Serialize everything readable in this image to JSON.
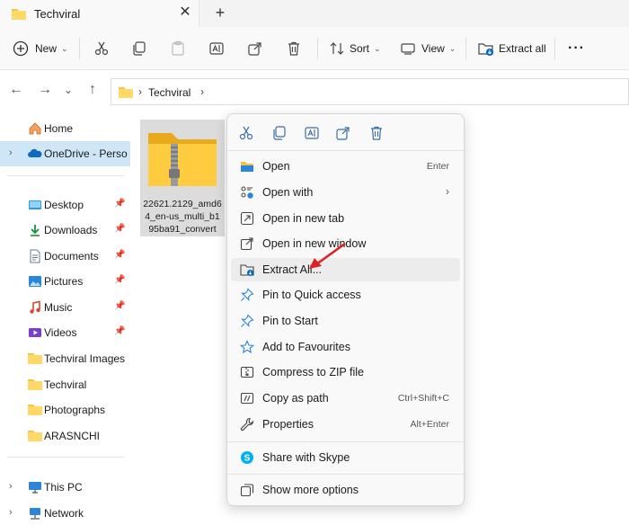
{
  "tab": {
    "title": "Techviral",
    "close": "✕",
    "new_tab": "+"
  },
  "commandbar": {
    "new_label": "New",
    "sort_label": "Sort",
    "view_label": "View",
    "extract_all_label": "Extract all",
    "more": "···"
  },
  "address": {
    "crumb": "Techviral",
    "sep": "›"
  },
  "sidebar": {
    "items": [
      {
        "label": "Home"
      },
      {
        "label": "OneDrive - Persona"
      },
      {
        "label": "Desktop"
      },
      {
        "label": "Downloads"
      },
      {
        "label": "Documents"
      },
      {
        "label": "Pictures"
      },
      {
        "label": "Music"
      },
      {
        "label": "Videos"
      },
      {
        "label": "Techviral Images"
      },
      {
        "label": "Techviral"
      },
      {
        "label": "Photographs"
      },
      {
        "label": "ARASNCHI"
      },
      {
        "label": "This PC"
      },
      {
        "label": "Network"
      }
    ]
  },
  "file": {
    "name": "22621.2129_amd64_en-us_multi_b195ba91_convert"
  },
  "context_menu": {
    "items": [
      {
        "label": "Open",
        "shortcut": "Enter"
      },
      {
        "label": "Open with",
        "arrow": "›"
      },
      {
        "label": "Open in new tab"
      },
      {
        "label": "Open in new window"
      },
      {
        "label": "Extract All..."
      },
      {
        "label": "Pin to Quick access"
      },
      {
        "label": "Pin to Start"
      },
      {
        "label": "Add to Favourites"
      },
      {
        "label": "Compress to ZIP file"
      },
      {
        "label": "Copy as path",
        "shortcut": "Ctrl+Shift+C"
      },
      {
        "label": "Properties",
        "shortcut": "Alt+Enter"
      },
      {
        "label": "Share with Skype"
      },
      {
        "label": "Show more options"
      }
    ]
  },
  "colors": {
    "accent": "#0067c0",
    "folder": "#f4c542",
    "selection": "#cfe6f7",
    "annotation_arrow": "#e02020"
  }
}
